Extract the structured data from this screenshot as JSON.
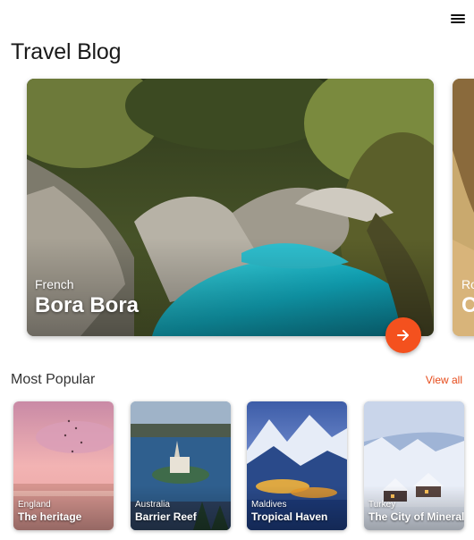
{
  "header": {
    "menu_icon": "hamburger-menu-icon",
    "title": "Travel Blog"
  },
  "featured": [
    {
      "country": "French",
      "name": "Bora Bora"
    },
    {
      "country": "Ro",
      "name": "C"
    }
  ],
  "featured_action_icon": "arrow-right-icon",
  "accent_color": "#f4511e",
  "popular": {
    "title": "Most Popular",
    "view_all_label": "View all",
    "items": [
      {
        "country": "England",
        "name": "The heritage"
      },
      {
        "country": "Australia",
        "name": "Barrier Reef"
      },
      {
        "country": "Maldives",
        "name": "Tropical Haven"
      },
      {
        "country": "Turkey",
        "name": "The City of Minerals"
      }
    ]
  }
}
